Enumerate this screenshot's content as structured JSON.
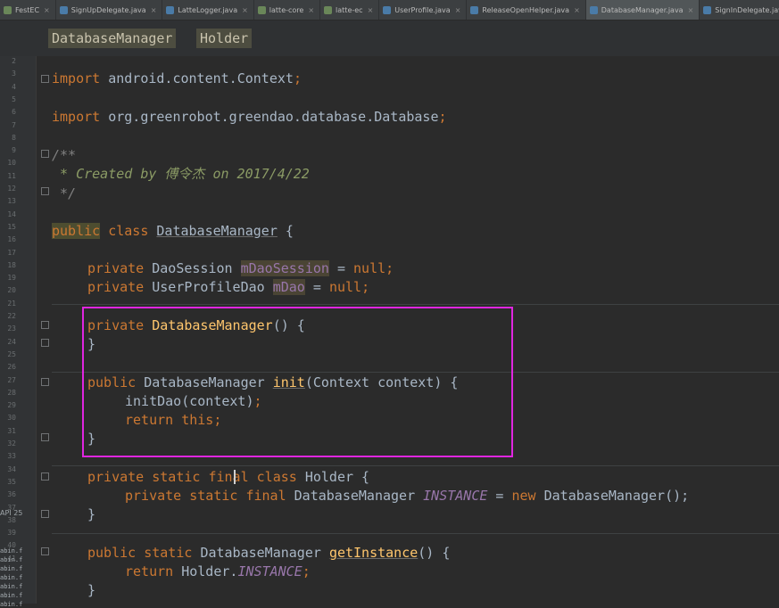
{
  "tabs": [
    {
      "label": "FestEC",
      "color": "#6a8759",
      "active": false
    },
    {
      "label": "SignUpDelegate.java",
      "color": "#4a7ba7",
      "active": false
    },
    {
      "label": "LatteLogger.java",
      "color": "#4a7ba7",
      "active": false
    },
    {
      "label": "latte-core",
      "color": "#6a8759",
      "active": false
    },
    {
      "label": "latte-ec",
      "color": "#6a8759",
      "active": false
    },
    {
      "label": "UserProfile.java",
      "color": "#4a7ba7",
      "active": false
    },
    {
      "label": "ReleaseOpenHelper.java",
      "color": "#4a7ba7",
      "active": false
    },
    {
      "label": "DatabaseManager.java",
      "color": "#4a7ba7",
      "active": true
    },
    {
      "label": "SignInDelegate.java",
      "color": "#4a7ba7",
      "active": false
    }
  ],
  "breadcrumb": [
    "DatabaseManager",
    "Holder"
  ],
  "line_numbers": [
    "2",
    "3",
    "4",
    "5",
    "6",
    "7",
    "8",
    "9",
    "10",
    "11",
    "12",
    "13",
    "14",
    "15",
    "16",
    "17",
    "18",
    "19",
    "20",
    "21",
    "22",
    "23",
    "24",
    "25",
    "26",
    "27",
    "28",
    "29",
    "30",
    "31",
    "32",
    "33",
    "34",
    "35",
    "36",
    "37",
    "38",
    "39",
    "40",
    "41"
  ],
  "code": {
    "import1": "import",
    "import1_pkg": " android.content.Context",
    "semi": ";",
    "import2": "import",
    "import2_pkg": " org.greenrobot.greendao.database.Database",
    "cm_open": "/**",
    "cm_created": " * Created by 傅令杰 on 2017/4/22",
    "cm_close": " */",
    "kw_public": "public",
    "kw_class": "class",
    "cls_name": "DatabaseManager",
    "brace_open": " {",
    "kw_private": "private",
    "kw_static": "static",
    "kw_final": "final",
    "kw_new": "new",
    "kw_return": "return",
    "kw_this": "this",
    "t_daosession": "DaoSession",
    "f_msession": "mDaoSession",
    "null_kw": "null",
    "eq": " = ",
    "t_userdao": "UserProfileDao",
    "f_mdao": "mDao",
    "ctor": "DatabaseManager",
    "parens_brace": "() {",
    "close": "}",
    "ret_type": "DatabaseManager",
    "m_init": "init",
    "init_params": "(Context context) {",
    "call_initdao": "initDao(context)",
    "holder_cls": "Holder",
    "instance": "INSTANCE",
    "new_call": "DatabaseManager();",
    "m_getinstance": "getInstance",
    "get_parens": "() {",
    "holder_ref": "Holder."
  },
  "sidepanel": {
    "api_label": "API 25",
    "items": [
      "abin.f",
      "abin.f",
      "abin.f",
      "abin.f",
      "abin.f",
      "abin.f",
      "abin.f"
    ]
  },
  "colors": {
    "keyword": "#cc7832",
    "method": "#ffc66d",
    "field": "#9876aa",
    "comment": "#808080",
    "highlight_box": "#e026e0"
  }
}
